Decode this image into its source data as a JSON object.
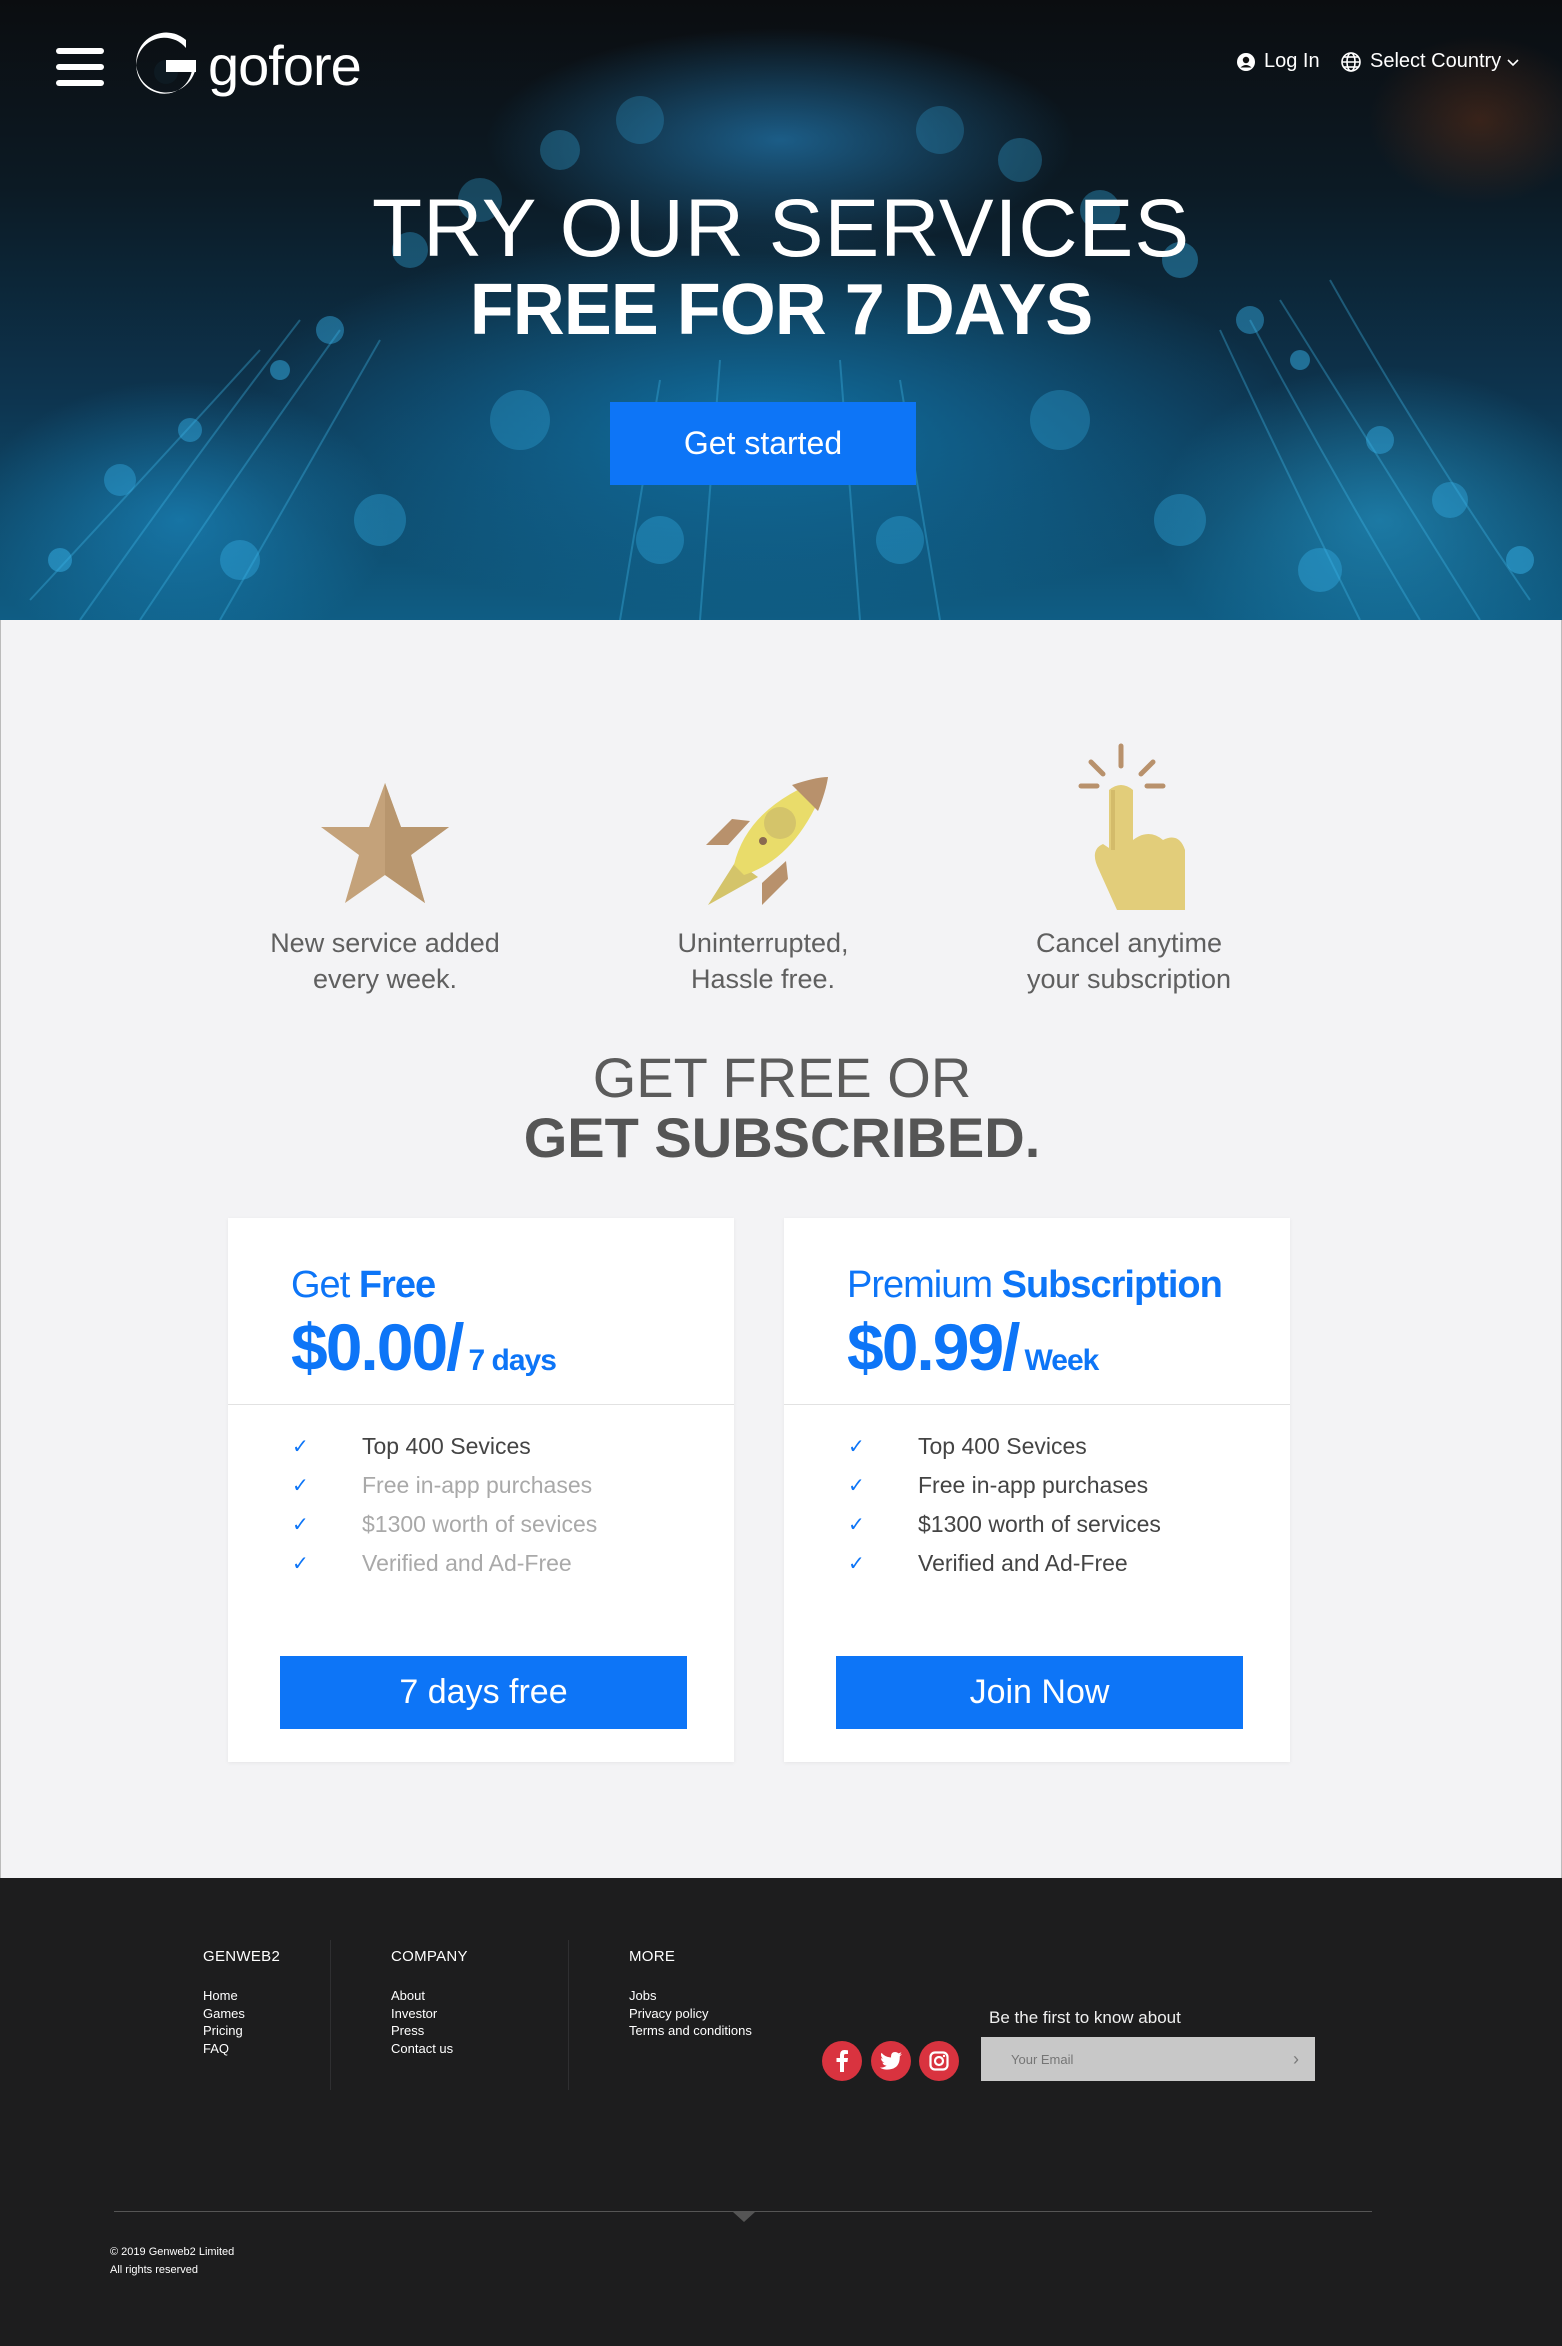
{
  "header": {
    "brand": "gofore",
    "login_label": "Log In",
    "country_label": "Select Country"
  },
  "hero": {
    "title_line1": "TRY OUR SERVICES",
    "title_line2": "FREE FOR 7 DAYS",
    "cta_label": "Get started"
  },
  "features": [
    {
      "icon": "star-icon",
      "line1": "New service added",
      "line2": "every week."
    },
    {
      "icon": "rocket-icon",
      "line1": "Uninterrupted,",
      "line2": "Hassle free."
    },
    {
      "icon": "tap-hand-icon",
      "line1": "Cancel anytime",
      "line2": "your subscription"
    }
  ],
  "plans_section": {
    "title_line1": "GET FREE OR",
    "title_line2": "GET SUBSCRIBED."
  },
  "plans": [
    {
      "name_light": "Get",
      "name_bold": "Free",
      "price": "$0.00/",
      "period": "7 days",
      "features": [
        {
          "text": "Top 400 Sevices",
          "included": true
        },
        {
          "text": "Free in-app purchases",
          "included": false
        },
        {
          "text": "$1300 worth of sevices",
          "included": false
        },
        {
          "text": "Verified and Ad-Free",
          "included": false
        }
      ],
      "button_label": "7 days free"
    },
    {
      "name_light": "Premium",
      "name_bold": "Subscription",
      "price": "$0.99/",
      "period": "Week",
      "features": [
        {
          "text": "Top 400 Sevices",
          "included": true
        },
        {
          "text": "Free in-app purchases",
          "included": true
        },
        {
          "text": "$1300 worth of services",
          "included": true
        },
        {
          "text": "Verified and Ad-Free",
          "included": true
        }
      ],
      "button_label": "Join Now"
    }
  ],
  "footer": {
    "columns": [
      {
        "heading": "GENWEB2",
        "links": [
          "Home",
          "Games",
          "Pricing",
          "FAQ"
        ]
      },
      {
        "heading": "COMPANY",
        "links": [
          "About",
          "Investor",
          "Press",
          "Contact us"
        ]
      },
      {
        "heading": "MORE",
        "links": [
          "Jobs",
          "Privacy policy",
          "Terms and conditions"
        ]
      }
    ],
    "social": [
      "facebook-icon",
      "twitter-icon",
      "instagram-icon"
    ],
    "newsletter_label": "Be the first to know about",
    "email_placeholder": "Your Email",
    "copyright_line1": "© 2019  Genweb2 Limited",
    "copyright_line2": "All rights reserved"
  },
  "colors": {
    "accent": "#0d75f7",
    "footer_bg": "#1d1d1e",
    "social": "#d9333f",
    "page_bg": "#f3f3f5"
  }
}
